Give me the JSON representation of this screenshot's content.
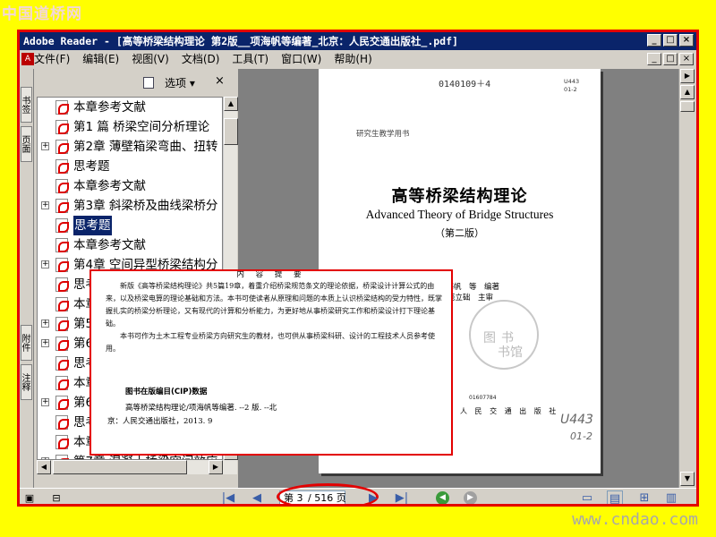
{
  "watermarks": {
    "top": "中国道桥网",
    "bottom": "www.cndao.com"
  },
  "window": {
    "title": "Adobe Reader - [高等桥梁结构理论  第2版__项海帆等编著_北京：人民交通出版社_.pdf]",
    "buttons": [
      "_",
      "□",
      "×"
    ]
  },
  "menu": {
    "items": [
      "文件(F)",
      "编辑(E)",
      "视图(V)",
      "文档(D)",
      "工具(T)",
      "窗口(W)",
      "帮助(H)"
    ],
    "right_buttons": [
      "_",
      "□",
      "×"
    ]
  },
  "side_tabs": [
    "书签",
    "页面",
    "附件",
    "注释"
  ],
  "panel": {
    "options_label": "选项 ▾",
    "close_label": "×"
  },
  "bookmarks": [
    {
      "label": "本章参考文献",
      "expandable": false,
      "selected": false
    },
    {
      "label": "第1 篇 桥梁空间分析理论",
      "expandable": false,
      "selected": false
    },
    {
      "label": "第2章 薄壁箱梁弯曲、扭转",
      "expandable": true,
      "selected": false
    },
    {
      "label": "思考题",
      "expandable": false,
      "selected": false
    },
    {
      "label": "本章参考文献",
      "expandable": false,
      "selected": false
    },
    {
      "label": "第3章 斜梁桥及曲线梁桥分",
      "expandable": true,
      "selected": false
    },
    {
      "label": "思考题",
      "expandable": false,
      "selected": true
    },
    {
      "label": "本章参考文献",
      "expandable": false,
      "selected": false
    },
    {
      "label": "第4章 空间异型桥梁结构分",
      "expandable": true,
      "selected": false
    },
    {
      "label": "思考题",
      "expandable": false,
      "selected": false
    },
    {
      "label": "本章参考文献",
      "expandable": false,
      "selected": false
    },
    {
      "label": "第5章",
      "expandable": true,
      "selected": false
    },
    {
      "label": "第6章",
      "expandable": true,
      "selected": false
    },
    {
      "label": "思考题",
      "expandable": false,
      "selected": false
    },
    {
      "label": "本章参考文献",
      "expandable": false,
      "selected": false
    },
    {
      "label": "第6章",
      "expandable": true,
      "selected": false
    },
    {
      "label": "思考题",
      "expandable": false,
      "selected": false
    },
    {
      "label": "本章参考文献",
      "expandable": false,
      "selected": false
    },
    {
      "label": "第7章 混凝土桥梁空间效应",
      "expandable": true,
      "selected": false
    }
  ],
  "document_page": {
    "serial": "0140109＋4",
    "call_number": [
      "U443",
      "01-2"
    ],
    "series_tag": "研究生教学用书",
    "title": "高等桥梁结构理论",
    "english_title": "Advanced Theory of Bridge Structures",
    "edition": "（第二版）",
    "authors_line1": "项海帆　等　编著",
    "authors_line2": "范立础　主审",
    "stamp_text_1": "图书",
    "stamp_text_2": "书馆",
    "barcode": "01607784",
    "publisher": "人 民 交 通 出 版 社",
    "handwriting_1": "U443",
    "handwriting_2": "01-2"
  },
  "popup": {
    "heading": "内 容 提 要",
    "paragraph1": "新版《高等桥梁结构理论》共5篇19章，着重介绍桥梁规范条文的理论依据，桥梁设计计算公式的由来，以及桥梁电算的理论基础和方法。本书可使读者从原理和问题的本质上认识桥梁结构的受力特性，既掌握扎实的桥梁分析理论，又有现代的计算和分析能力，为更好地从事桥梁研究工作和桥梁设计打下理论基础。",
    "paragraph2": "本书可作为土木工程专业桥梁方向研究生的教材，也可供从事桥梁科研、设计的工程技术人员参考使用。",
    "cip_title": "图书在版编目(CIP)数据",
    "cip_line1": "高等桥梁结构理论/项海帆等编著. --2 版. --北",
    "cip_line2": "京：人民交通出版社，2013. 9"
  },
  "statusbar": {
    "page_current": "第 3",
    "page_total": "/ 516 页",
    "first": "|◀",
    "prev": "◀",
    "next": "▶",
    "last": "▶|",
    "back": "◀",
    "forward": "▶"
  },
  "colors": {
    "highlight": "#e30000",
    "titlebar": "#0a246a",
    "background": "#ffff00"
  }
}
